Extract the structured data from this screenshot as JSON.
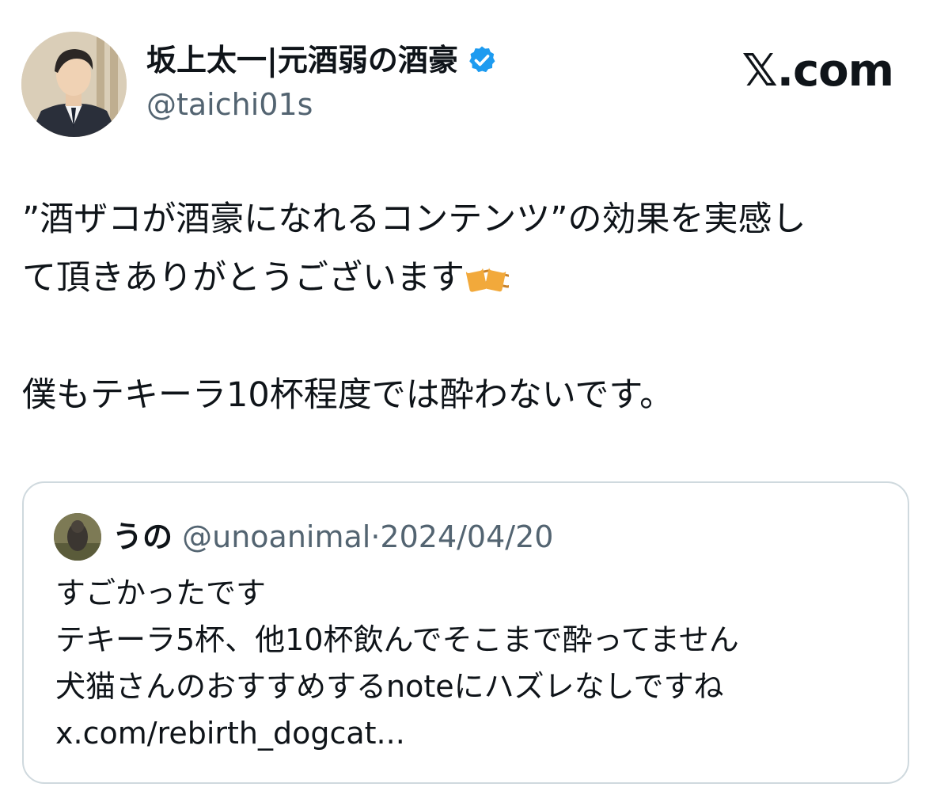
{
  "tweet": {
    "display_name": "坂上太一|元酒弱の酒豪",
    "handle": "@taichi01s",
    "verified_icon": "verified-badge-icon",
    "text_line1": "”酒ザコが酒豪になれるコンテンツ”の効果を実感し",
    "text_line2": "て頂きありがとうございます",
    "emoji_name": "clinking-beer-mugs-icon",
    "text_line3": "僕もテキーラ10杯程度では酔わないです。"
  },
  "brand": {
    "label": "𝕏.com"
  },
  "quote": {
    "name": "うの",
    "handle": "@unoanimal",
    "separator": "·",
    "date": "2024/04/20",
    "lines": [
      "すごかったです",
      "テキーラ5杯、他10杯飲んでそこまで酔ってません",
      "犬猫さんのおすすめするnoteにハズレなしですね",
      "x.com/rebirth_dogcat..."
    ]
  },
  "colors": {
    "text": "#0f1419",
    "secondary": "#536471",
    "verified": "#1d9bf0",
    "border": "#cfd9de"
  }
}
